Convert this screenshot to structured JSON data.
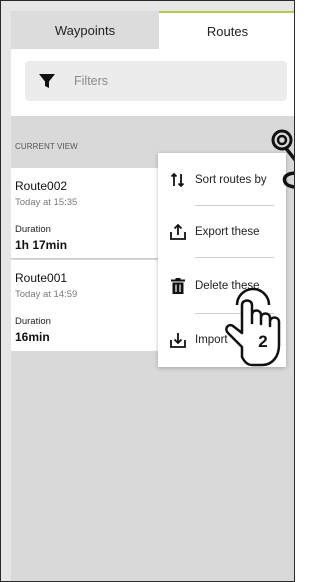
{
  "tabs": {
    "waypoints_label": "Waypoints",
    "routes_label": "Routes",
    "active": "Routes"
  },
  "filter": {
    "label": "Filters",
    "icon": "filter-icon"
  },
  "section": {
    "title": "CURRENT VIEW"
  },
  "routes": [
    {
      "name": "Route002",
      "time": "Today at 15:35",
      "duration_label": "Duration",
      "duration_value": "1h 17min"
    },
    {
      "name": "Route001",
      "time": "Today at 14:59",
      "duration_label": "Duration",
      "duration_value": "16min"
    }
  ],
  "menu": {
    "items": [
      {
        "label": "Sort routes by",
        "icon": "sort-icon"
      },
      {
        "label": "Export these",
        "icon": "export-icon"
      },
      {
        "label": "Delete these",
        "icon": "trash-icon"
      },
      {
        "label": "Import",
        "icon": "import-icon"
      }
    ]
  },
  "annotation": {
    "step_number": "2"
  },
  "colors": {
    "active_tab_accent": "#b7c94e",
    "background": "#d9d9d9",
    "card": "#ffffff"
  }
}
